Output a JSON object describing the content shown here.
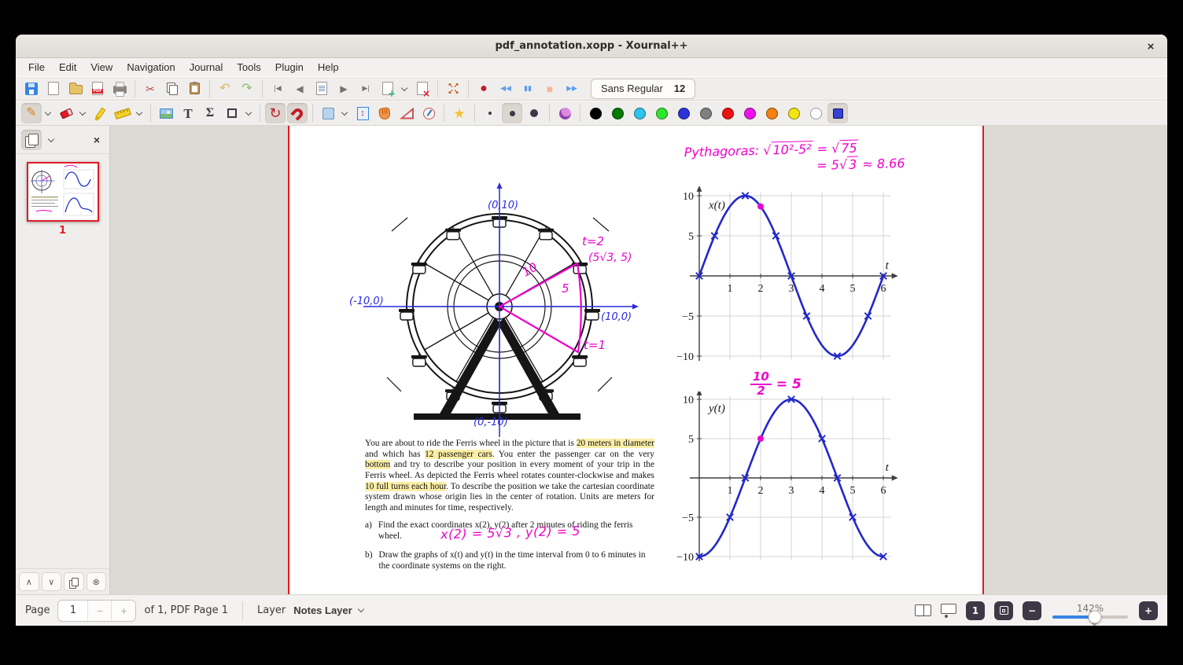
{
  "window": {
    "title": "pdf_annotation.xopp - Xournal++",
    "close_glyph": "×"
  },
  "menu": {
    "items": [
      "File",
      "Edit",
      "View",
      "Navigation",
      "Journal",
      "Tools",
      "Plugin",
      "Help"
    ]
  },
  "toolbar_main": {
    "font_button": {
      "name": "Sans Regular",
      "size": "12"
    },
    "items": [
      {
        "name": "save-icon",
        "kind": "floppy"
      },
      {
        "name": "new-document-icon",
        "kind": "doc"
      },
      {
        "name": "open-folder-icon",
        "kind": "folder"
      },
      {
        "name": "export-pdf-icon",
        "kind": "pdfdoc"
      },
      {
        "name": "print-icon",
        "kind": "print"
      },
      {
        "kind": "sep"
      },
      {
        "name": "cut-icon",
        "kind": "glyph",
        "glyph": "✂",
        "color": "#c04a4a",
        "size": 14
      },
      {
        "name": "copy-icon",
        "kind": "copyic"
      },
      {
        "name": "paste-icon",
        "kind": "paste"
      },
      {
        "kind": "sep"
      },
      {
        "name": "undo-icon",
        "kind": "glyph",
        "glyph": "↶",
        "color": "#d8b868",
        "size": 16
      },
      {
        "name": "redo-icon",
        "kind": "glyph",
        "glyph": "↷",
        "color": "#8ac06a",
        "size": 16
      },
      {
        "kind": "sep"
      },
      {
        "name": "first-page-icon",
        "kind": "glyph",
        "glyph": "|◀",
        "color": "#77726c"
      },
      {
        "name": "previous-page-icon",
        "kind": "glyph",
        "glyph": "◀",
        "color": "#77726c",
        "size": 12
      },
      {
        "name": "page-preview-icon",
        "kind": "preview"
      },
      {
        "name": "next-page-icon",
        "kind": "glyph",
        "glyph": "▶",
        "color": "#77726c",
        "size": 12
      },
      {
        "name": "last-page-icon",
        "kind": "glyph",
        "glyph": "▶|",
        "color": "#77726c"
      },
      {
        "name": "add-page-icon",
        "kind": "docplus"
      },
      {
        "name": "add-page-dropdown-icon",
        "kind": "chev"
      },
      {
        "name": "delete-page-icon",
        "kind": "docx"
      },
      {
        "kind": "sep"
      },
      {
        "name": "fullscreen-icon",
        "kind": "fs"
      },
      {
        "kind": "sep"
      },
      {
        "name": "record-icon",
        "kind": "glyph",
        "glyph": "●",
        "color": "#c01c28",
        "size": 16
      },
      {
        "name": "rewind-icon",
        "kind": "glyph",
        "glyph": "◀◀",
        "color": "#62a0ea"
      },
      {
        "name": "pause-icon",
        "kind": "glyph",
        "glyph": "▮▮",
        "color": "#62a0ea"
      },
      {
        "name": "stop-icon",
        "kind": "glyph",
        "glyph": "■",
        "color": "#f5b89c",
        "size": 14
      },
      {
        "name": "fast-forward-icon",
        "kind": "glyph",
        "glyph": "▶▶",
        "color": "#62a0ea"
      }
    ]
  },
  "toolbar_tools": {
    "items": [
      {
        "name": "pen-tool-icon",
        "kind": "glyph",
        "glyph": "✎",
        "color": "#d9862a",
        "size": 16,
        "selected": true
      },
      {
        "name": "pen-options-chevron-icon",
        "kind": "chev"
      },
      {
        "name": "eraser-tool-icon",
        "kind": "eraser"
      },
      {
        "name": "eraser-options-chevron-icon",
        "kind": "chev"
      },
      {
        "name": "highlighter-tool-icon",
        "kind": "hl"
      },
      {
        "name": "ruler-tool-icon",
        "kind": "ruler"
      },
      {
        "name": "ruler-options-chevron-icon",
        "kind": "chev"
      },
      {
        "kind": "sep"
      },
      {
        "name": "image-tool-icon",
        "kind": "img"
      },
      {
        "name": "text-tool-icon",
        "kind": "glyph",
        "glyph": "T",
        "color": "#3d3846",
        "size": 17,
        "serif": true
      },
      {
        "name": "math-tex-tool-icon",
        "kind": "glyph",
        "glyph": "Σ",
        "color": "#3d3846",
        "size": 16,
        "serif": true
      },
      {
        "name": "shape-tool-icon",
        "kind": "shapesq"
      },
      {
        "name": "shape-options-chevron-icon",
        "kind": "chev"
      },
      {
        "kind": "sep"
      },
      {
        "name": "snap-rotation-icon",
        "kind": "glyph",
        "glyph": "↻",
        "color": "#c01c28",
        "size": 18,
        "selected": true
      },
      {
        "name": "snap-grid-magnet-icon",
        "kind": "magnet",
        "selected": true
      },
      {
        "kind": "sep"
      },
      {
        "name": "select-region-icon",
        "kind": "selrect"
      },
      {
        "name": "select-options-chevron-icon",
        "kind": "chev"
      },
      {
        "name": "vertical-space-tool-icon",
        "kind": "vspace"
      },
      {
        "name": "hand-tool-icon",
        "kind": "hand"
      },
      {
        "name": "setsquare-tool-icon",
        "kind": "setsquare"
      },
      {
        "name": "compass-tool-icon",
        "kind": "compass"
      },
      {
        "kind": "sep"
      },
      {
        "name": "shape-recognizer-icon",
        "kind": "glyph",
        "glyph": "★",
        "color": "#f6c12d",
        "size": 17
      },
      {
        "kind": "sep"
      },
      {
        "name": "thickness-fine-icon",
        "kind": "dotS"
      },
      {
        "name": "thickness-medium-icon",
        "kind": "dotM",
        "selected": true
      },
      {
        "name": "thickness-thick-icon",
        "kind": "dotL"
      },
      {
        "kind": "sep"
      },
      {
        "name": "fill-tool-icon",
        "kind": "fill"
      },
      {
        "kind": "sep"
      },
      {
        "name": "color-swatch-black",
        "kind": "swatch",
        "color": "#000000"
      },
      {
        "name": "color-swatch-green",
        "kind": "swatch",
        "color": "#007a00"
      },
      {
        "name": "color-swatch-cyan",
        "kind": "swatch",
        "color": "#2fc4f0"
      },
      {
        "name": "color-swatch-lime",
        "kind": "swatch",
        "color": "#2ee62e"
      },
      {
        "name": "color-swatch-blue",
        "kind": "swatch",
        "color": "#2b34d8"
      },
      {
        "name": "color-swatch-gray",
        "kind": "swatch",
        "color": "#808080"
      },
      {
        "name": "color-swatch-red",
        "kind": "swatch",
        "color": "#ee1111"
      },
      {
        "name": "color-swatch-magenta",
        "kind": "swatch",
        "color": "#ee11ee"
      },
      {
        "name": "color-swatch-orange",
        "kind": "swatch",
        "color": "#f58111"
      },
      {
        "name": "color-swatch-yellow",
        "kind": "swatch",
        "color": "#f5e411"
      },
      {
        "name": "color-swatch-white",
        "kind": "swatch",
        "color": "#ffffff"
      },
      {
        "name": "color-picker-icon",
        "kind": "colorsel"
      }
    ]
  },
  "sidebar": {
    "page_thumbnail_label": "1"
  },
  "statusbar": {
    "page_label": "Page",
    "page_value": "1",
    "page_decrement": "−",
    "page_increment": "+",
    "page_info": "of 1, PDF Page 1",
    "layer_label": "Layer",
    "layer_name": "Notes Layer",
    "zoom_level": "142%",
    "zoom_100_label": "1",
    "zoom_out_label": "−",
    "zoom_in_label": "+"
  },
  "page": {
    "pythagoras": {
      "lead": "Pythagoras:",
      "sqrt_sign": "√",
      "sqrt1": "10²-5²",
      "equals": "=",
      "sqrt2": "75",
      "line2_lead": "= 5",
      "sqrt3": "3",
      "line2_tail": "≈ 8.66"
    },
    "wheel_labels": {
      "top": "(0,10)",
      "left": "(-10,0)",
      "right": "(10,0)",
      "bottom": "(0,-10)",
      "t2": "t=2",
      "point": "(5√3, 5)",
      "radius": "10",
      "height": "5",
      "t1": "t=1"
    },
    "paragraph": [
      {
        "text": "You are about to ride the Ferris wheel in the picture that is ",
        "highlight": false
      },
      {
        "text": "20 meters in diameter",
        "highlight": true
      },
      {
        "text": " and which has ",
        "highlight": false
      },
      {
        "text": "12 passenger cars",
        "highlight": true
      },
      {
        "text": ".  You enter the passenger car on the very ",
        "highlight": false
      },
      {
        "text": "bottom",
        "highlight": true
      },
      {
        "text": " and try to describe your position in every moment of your trip in the Ferris wheel.  As depicted the Ferris wheel rotates counter-clockwise and makes ",
        "highlight": false
      },
      {
        "text": "10 full turns each hour",
        "highlight": true
      },
      {
        "text": ".  To describe the position we take the cartesian coordinate system drawn whose origin lies in the center of rotation.  Units are meters for length and minutes for time, respectively.",
        "highlight": false
      }
    ],
    "items": {
      "a_label": "a)",
      "a_text": "Find the exact coordinates x(2), y(2) after 2 minutes of riding the ferris wheel.",
      "b_label": "b)",
      "b_text": "Draw the graphs of x(t) and y(t) in the time interval from 0 to 6 minutes in the coordinate systems on the right."
    },
    "handwritten_answer": "x(2) = 5√3 , y(2) = 5",
    "fraction_annotation": {
      "numerator": "10",
      "denominator": "2",
      "rhs": "= 5"
    }
  },
  "chart_data": [
    {
      "type": "line",
      "title": "x(t)",
      "xlabel": "t",
      "x_range": [
        0,
        6
      ],
      "y_range": [
        -10,
        10
      ],
      "x_ticks": [
        1,
        2,
        3,
        4,
        5,
        6
      ],
      "y_ticks": [
        10,
        5,
        -5,
        -10
      ],
      "grid": true,
      "curve": {
        "form": "sin",
        "amplitude": 10,
        "period": 6
      },
      "curve_color": "#2229c7",
      "markers": [
        [
          0,
          0
        ],
        [
          0.5,
          5
        ],
        [
          1.5,
          10
        ],
        [
          2.5,
          5
        ],
        [
          3,
          0
        ],
        [
          3.5,
          -5
        ],
        [
          4.5,
          -10
        ],
        [
          5.5,
          -5
        ],
        [
          6,
          0
        ]
      ],
      "highlight_point": {
        "t": 2,
        "value": 8.66,
        "color": "#ee00cc"
      }
    },
    {
      "type": "line",
      "title": "y(t)",
      "xlabel": "t",
      "x_range": [
        0,
        6
      ],
      "y_range": [
        -10,
        10
      ],
      "x_ticks": [
        1,
        2,
        3,
        4,
        5,
        6
      ],
      "y_ticks": [
        10,
        5,
        -5,
        -10
      ],
      "grid": true,
      "curve": {
        "form": "neg_cos",
        "amplitude": 10,
        "period": 6
      },
      "curve_color": "#2229c7",
      "markers": [
        [
          0,
          -10
        ],
        [
          1,
          -5
        ],
        [
          1.5,
          0
        ],
        [
          3,
          10
        ],
        [
          4,
          5
        ],
        [
          4.5,
          0
        ],
        [
          5,
          -5
        ],
        [
          6,
          -10
        ]
      ],
      "highlight_point": {
        "t": 2,
        "value": 5,
        "color": "#ee00cc"
      }
    }
  ]
}
